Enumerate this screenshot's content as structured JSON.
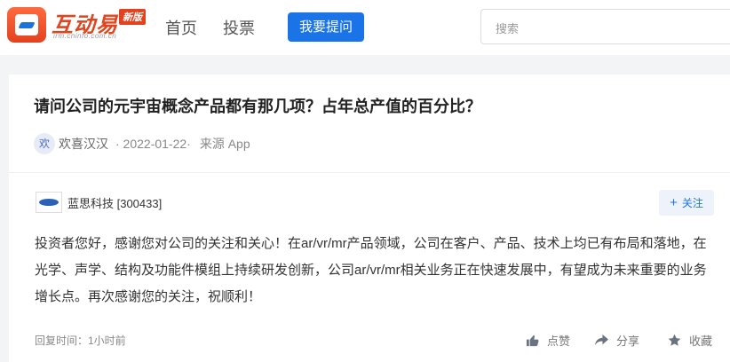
{
  "header": {
    "logo_text": "互动易",
    "logo_sub": "irm.cninfo.com.cn",
    "logo_badge": "新版",
    "nav": [
      "首页",
      "投票"
    ],
    "ask_button": "我要提问",
    "search_placeholder": "搜索"
  },
  "question": {
    "title": "请问公司的元宇宙概念产品都有那几项？占年总产值的百分比？",
    "avatar_char": "欢",
    "user": "欢喜汉汉",
    "date": "· 2022-01-22·",
    "source": "来源 App"
  },
  "answer": {
    "company": "蓝思科技 [300433]",
    "follow_button": "关注",
    "text": "投资者您好，感谢您对公司的关注和关心！在ar/vr/mr产品领域，公司在客户、产品、技术上均已有布局和落地，在光学、声学、结构及功能件模组上持续研发创新，公司ar/vr/mr相关业务正在快速发展中，有望成为未来重要的业务增长点。再次感谢您的关注，祝顺利！",
    "reply_time": "回复时间：1小时前",
    "actions": {
      "like": "点赞",
      "share": "分享",
      "favorite": "收藏"
    }
  }
}
